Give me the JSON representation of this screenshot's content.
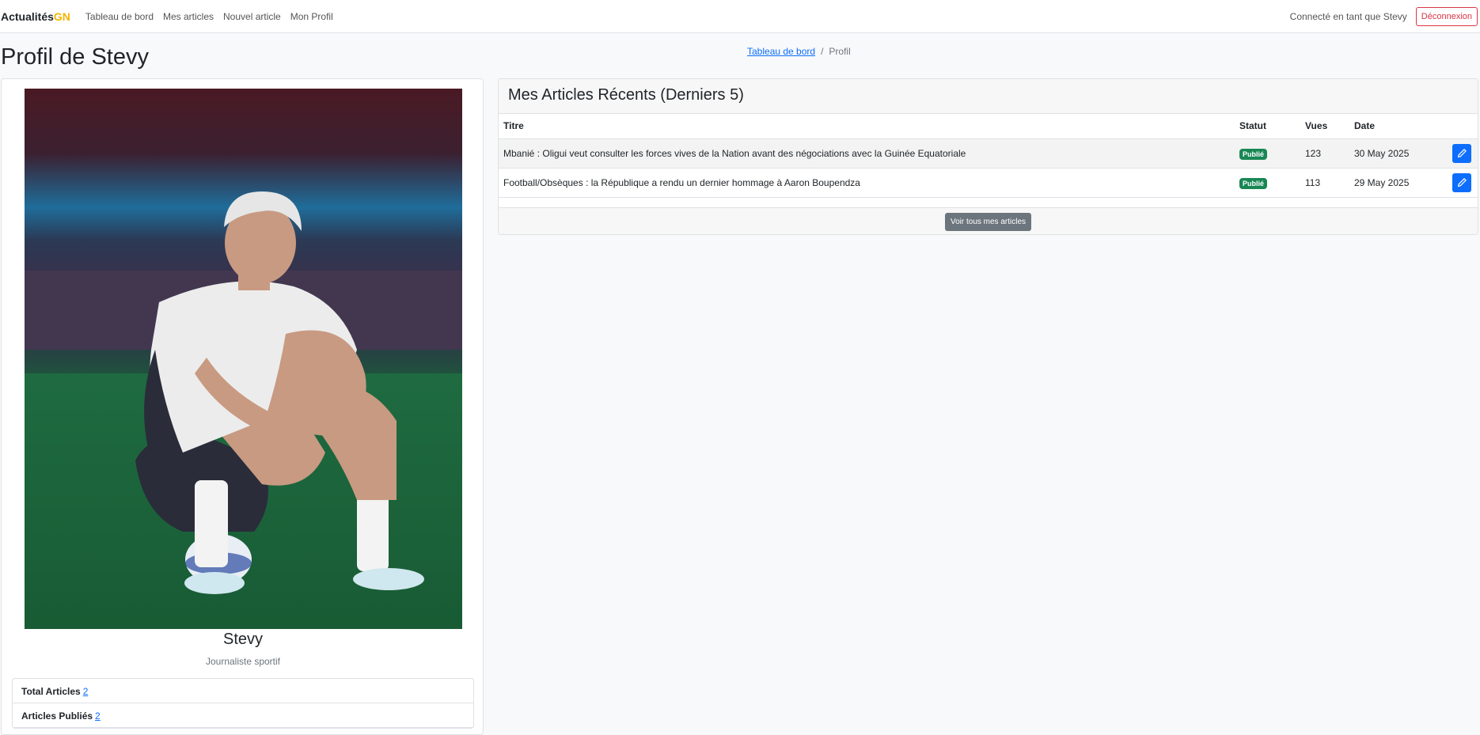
{
  "navbar": {
    "brand_main": "Actualités",
    "brand_accent": "GN",
    "links": [
      "Tableau de bord",
      "Mes articles",
      "Nouvel article",
      "Mon Profil"
    ],
    "user_text": "Connecté en tant que Stevy",
    "logout_label": "Déconnexion"
  },
  "header": {
    "title": "Profil de Stevy",
    "breadcrumb": {
      "link": "Tableau de bord",
      "separator": "/",
      "current": "Profil"
    }
  },
  "profile": {
    "name": "Stevy",
    "role": "Journaliste sportif",
    "stats": [
      {
        "label": "Total Articles",
        "value": "2"
      },
      {
        "label": "Articles Publiés",
        "value": "2"
      }
    ]
  },
  "articles": {
    "title": "Mes Articles Récents (Derniers 5)",
    "columns": [
      "Titre",
      "Statut",
      "Vues",
      "Date"
    ],
    "rows": [
      {
        "title": "Mbanié : Oligui veut consulter les forces vives de la Nation avant des négociations avec la Guinée Equatoriale",
        "status": "Publié",
        "views": "123",
        "date": "30 May 2025"
      },
      {
        "title": "Football/Obsèques : la République a rendu un dernier hommage à Aaron Boupendza",
        "status": "Publié",
        "views": "113",
        "date": "29 May 2025"
      }
    ],
    "view_all_label": "Voir tous mes articles"
  },
  "colors": {
    "accent": "#f5b400",
    "primary": "#0d6efd",
    "success": "#198754",
    "danger": "#dc3545",
    "secondary": "#6c757d"
  }
}
